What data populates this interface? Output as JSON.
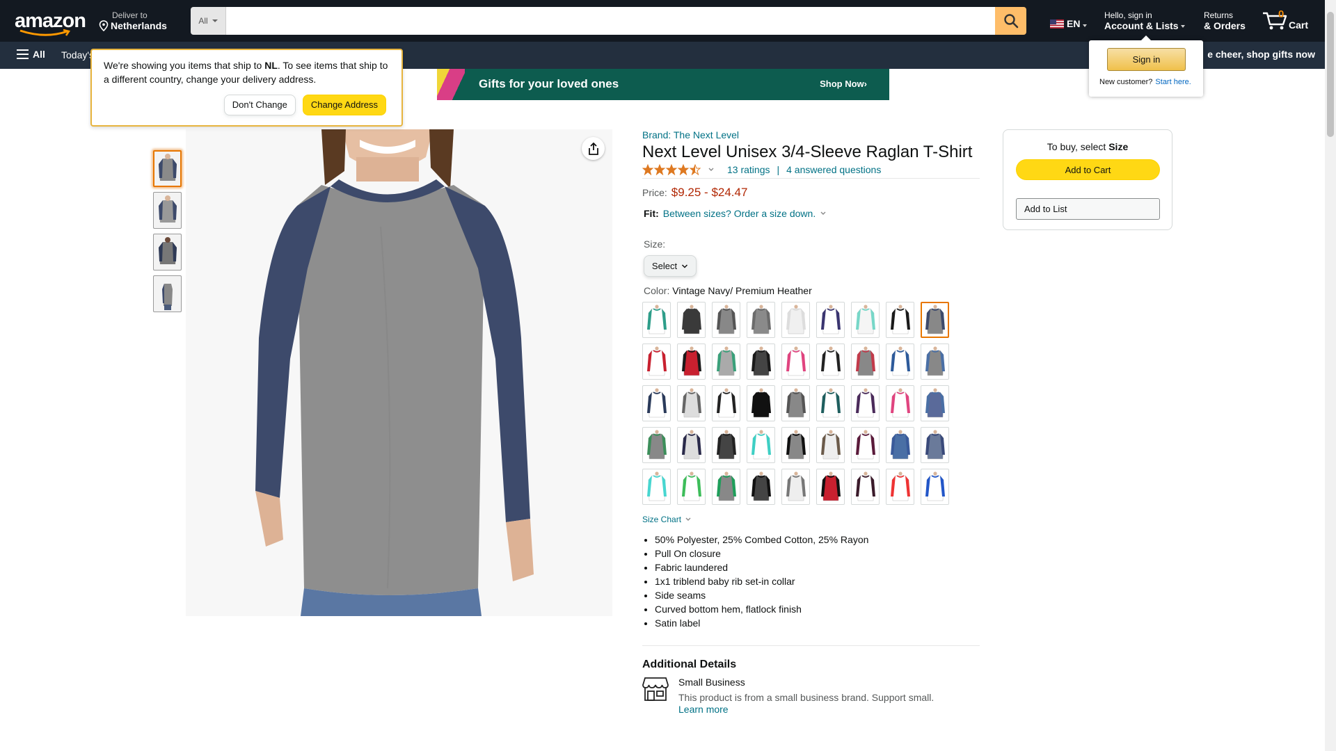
{
  "header": {
    "deliver_line1": "Deliver to",
    "deliver_line2": "Netherlands",
    "search_category": "All",
    "search_placeholder": "",
    "language": "EN",
    "account_line1": "Hello, sign in",
    "account_line2": "Account & Lists",
    "returns_line1": "Returns",
    "returns_line2": "& Orders",
    "cart_count": "0",
    "cart_label": "Cart"
  },
  "subnav": {
    "all_label": "All",
    "today_label": "Today's",
    "promo_label": "Bring the cheer, shop gifts now",
    "promo_visible": "e cheer, shop gifts now"
  },
  "popover": {
    "text_before": "We're showing you items that ship to ",
    "country": "NL",
    "text_after": ". To see items that ship to a different country, change your delivery address.",
    "dont_change": "Don't Change",
    "change_address": "Change Address"
  },
  "signin_flyout": {
    "button": "Sign in",
    "new_customer": "New customer?",
    "start_here": "Start here."
  },
  "banner": {
    "text": "Gifts for your loved ones",
    "cta": "Shop Now›"
  },
  "product": {
    "brand": "Brand: The Next Level",
    "title": "Next Level Unisex 3/4-Sleeve Raglan T-Shirt",
    "rating_value": 4.5,
    "ratings_count": "13 ratings",
    "answered_questions": "4 answered questions",
    "price_label": "Price:",
    "price_range": "$9.25 - $24.47",
    "fit_label": "Fit:",
    "fit_text": "Between sizes? Order a size down.",
    "size_label": "Size:",
    "size_select": "Select",
    "color_label": "Color:",
    "color_value": "Vintage Navy/ Premium Heather",
    "size_chart": "Size Chart",
    "bullets": [
      "50% Polyester, 25% Combed Cotton, 25% Rayon",
      "Pull On closure",
      "Fabric laundered",
      "1x1 triblend baby rib set-in collar",
      "Side seams",
      "Curved bottom hem, flatlock finish",
      "Satin label"
    ],
    "additional_details": "Additional Details",
    "small_business_title": "Small Business",
    "small_business_text": "This product is from a small business brand. Support small.",
    "learn_more": "Learn more"
  },
  "buybox": {
    "to_buy_prefix": "To buy, select ",
    "to_buy_bold": "Size",
    "add_to_cart": "Add to Cart",
    "add_to_list": "Add to List"
  },
  "swatch_colors": [
    [
      "#2E9E8A",
      "#fff"
    ],
    [
      "#3a3a3a",
      "#3a3a3a"
    ],
    [
      "#555",
      "#888"
    ],
    [
      "#6b6b6b",
      "#8a8a8a"
    ],
    [
      "#ddd",
      "#f0f0f0"
    ],
    [
      "#3a3570",
      "#fff"
    ],
    [
      "#77D7C8",
      "#f5f5f5"
    ],
    [
      "#1a1a1a",
      "#fff"
    ],
    [
      "#3d4a6b",
      "#888"
    ],
    [
      "#C8202F",
      "#fff"
    ],
    [
      "#1a1a1a",
      "#C8202F"
    ],
    [
      "#3aa07a",
      "#aaa"
    ],
    [
      "#1a1a1a",
      "#444"
    ],
    [
      "#E0447F",
      "#fff"
    ],
    [
      "#222",
      "#fff"
    ],
    [
      "#C23A4A",
      "#888"
    ],
    [
      "#2D5A9A",
      "#fff"
    ],
    [
      "#4A6FA5",
      "#888"
    ],
    [
      "#2a3a5a",
      "#fff"
    ],
    [
      "#666",
      "#ddd"
    ],
    [
      "#222",
      "#fff"
    ],
    [
      "#111",
      "#111"
    ],
    [
      "#555",
      "#888"
    ],
    [
      "#1E5E5E",
      "#fff"
    ],
    [
      "#4a2a5a",
      "#fff"
    ],
    [
      "#E0447F",
      "#fff"
    ],
    [
      "#4A6FA5",
      "#5a6a9a"
    ],
    [
      "#3C8E5A",
      "#888"
    ],
    [
      "#2a2a4a",
      "#ddd"
    ],
    [
      "#222",
      "#444"
    ],
    [
      "#3ECFC4",
      "#fff"
    ],
    [
      "#111",
      "#888"
    ],
    [
      "#6b5a4a",
      "#eee"
    ],
    [
      "#5a1a3a",
      "#fff"
    ],
    [
      "#3a5a9a",
      "#4A6FA5"
    ],
    [
      "#3a4a7a",
      "#6a7a9a"
    ],
    [
      "#48D6D0",
      "#fff"
    ],
    [
      "#3DBD5A",
      "#fff"
    ],
    [
      "#1E9E5A",
      "#888"
    ],
    [
      "#111",
      "#444"
    ],
    [
      "#777",
      "#eee"
    ],
    [
      "#111",
      "#C8202F"
    ],
    [
      "#3a1a2a",
      "#fff"
    ],
    [
      "#E33",
      "#fff"
    ],
    [
      "#2256C8",
      "#fff"
    ]
  ],
  "selected_swatch_index": 8,
  "selected_thumb_index": 0
}
